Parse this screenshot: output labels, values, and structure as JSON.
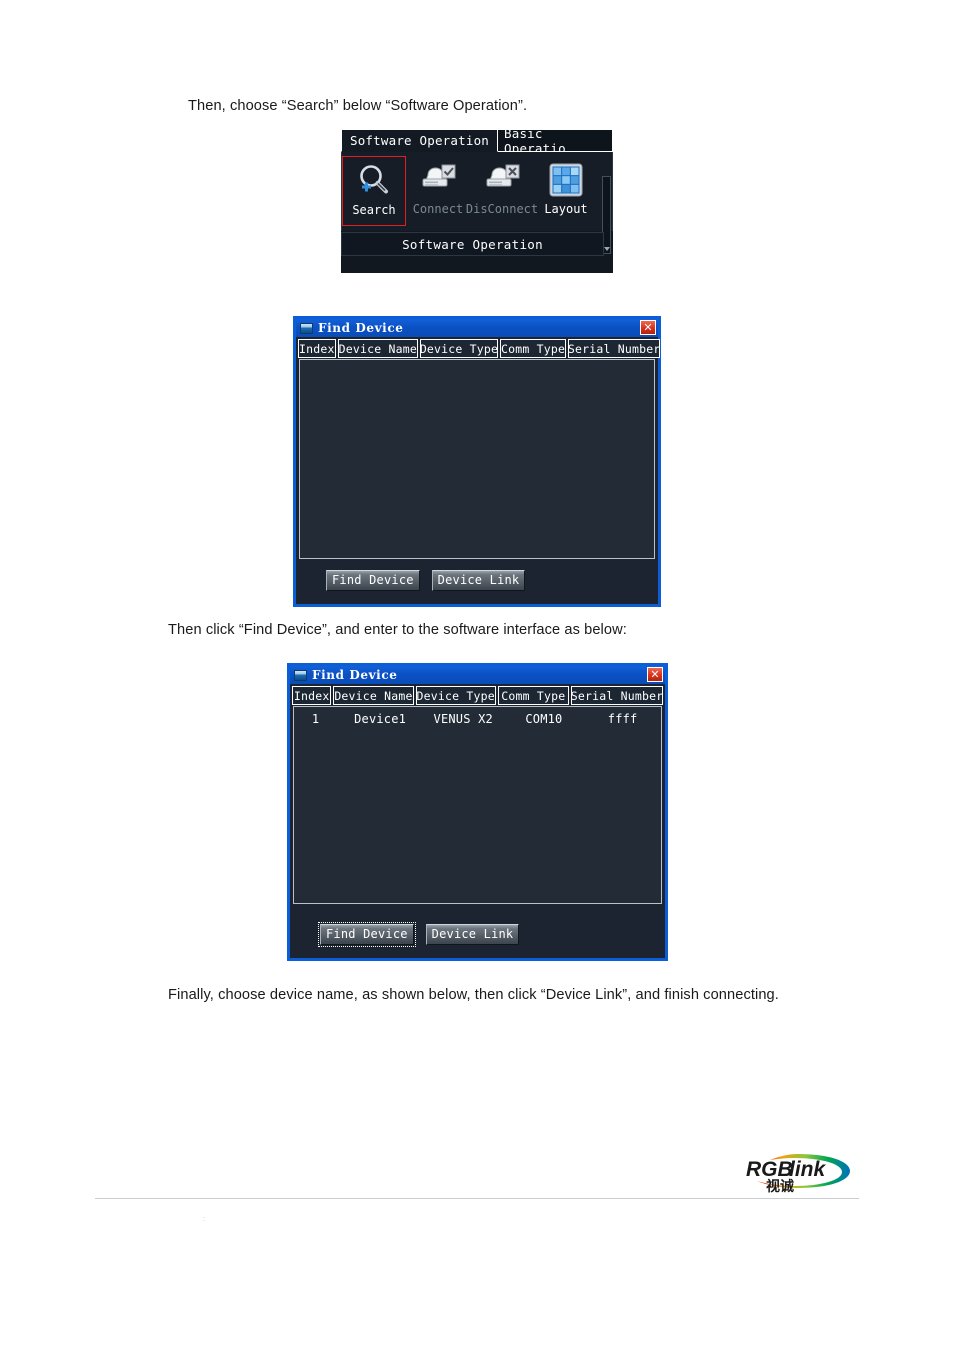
{
  "document": {
    "paragraphs": [
      "Then, choose “Search” below “Software Operation”.",
      "Then click “Find Device”, and enter to the software interface as below:",
      "Finally, choose device name, as shown below, then click “Device Link”, and finish connecting."
    ],
    "footer": {
      "marks": ":",
      "logo_text": "RGBlink",
      "logo_subtext": "视诚"
    }
  },
  "toolbar_screenshot": {
    "tabs": [
      {
        "label": "Software Operation",
        "active": true
      },
      {
        "label": "Basic Operatio",
        "active": false
      }
    ],
    "tools": [
      {
        "label": "Search",
        "icon": "magnifier-plus-icon",
        "disabled": false,
        "selected": true
      },
      {
        "label": "Connect",
        "icon": "printer-check-icon",
        "disabled": true,
        "selected": false
      },
      {
        "label": "DisConnect",
        "icon": "printer-x-icon",
        "disabled": true,
        "selected": false
      },
      {
        "label": "Layout",
        "icon": "grid-layout-icon",
        "disabled": false,
        "selected": false
      }
    ],
    "status_bar": "Software Operation"
  },
  "dialog_empty": {
    "title": "Find Device",
    "close_label": "✕",
    "columns": [
      "Index",
      "Device Name",
      "Device Type",
      "Comm Type",
      "Serial Number"
    ],
    "rows": [],
    "buttons": [
      {
        "label": "Find Device",
        "focused": false
      },
      {
        "label": "Device Link",
        "focused": false
      }
    ]
  },
  "dialog_found": {
    "title": "Find Device",
    "close_label": "✕",
    "columns": [
      "Index",
      "Device Name",
      "Device Type",
      "Comm Type",
      "Serial Number"
    ],
    "rows": [
      {
        "index": "1",
        "device_name": "Device1",
        "device_type": "VENUS X2",
        "comm_type": "COM10",
        "serial_number": "ffff"
      }
    ],
    "buttons": [
      {
        "label": "Find Device",
        "focused": true
      },
      {
        "label": "Device Link",
        "focused": false
      }
    ]
  },
  "colors": {
    "dialog_border": "#0b5ed7",
    "titlebar": "#0b51c4",
    "close_button": "#d8321c",
    "selection_highlight": "#e02020",
    "panel_dark": "#1b2430"
  }
}
